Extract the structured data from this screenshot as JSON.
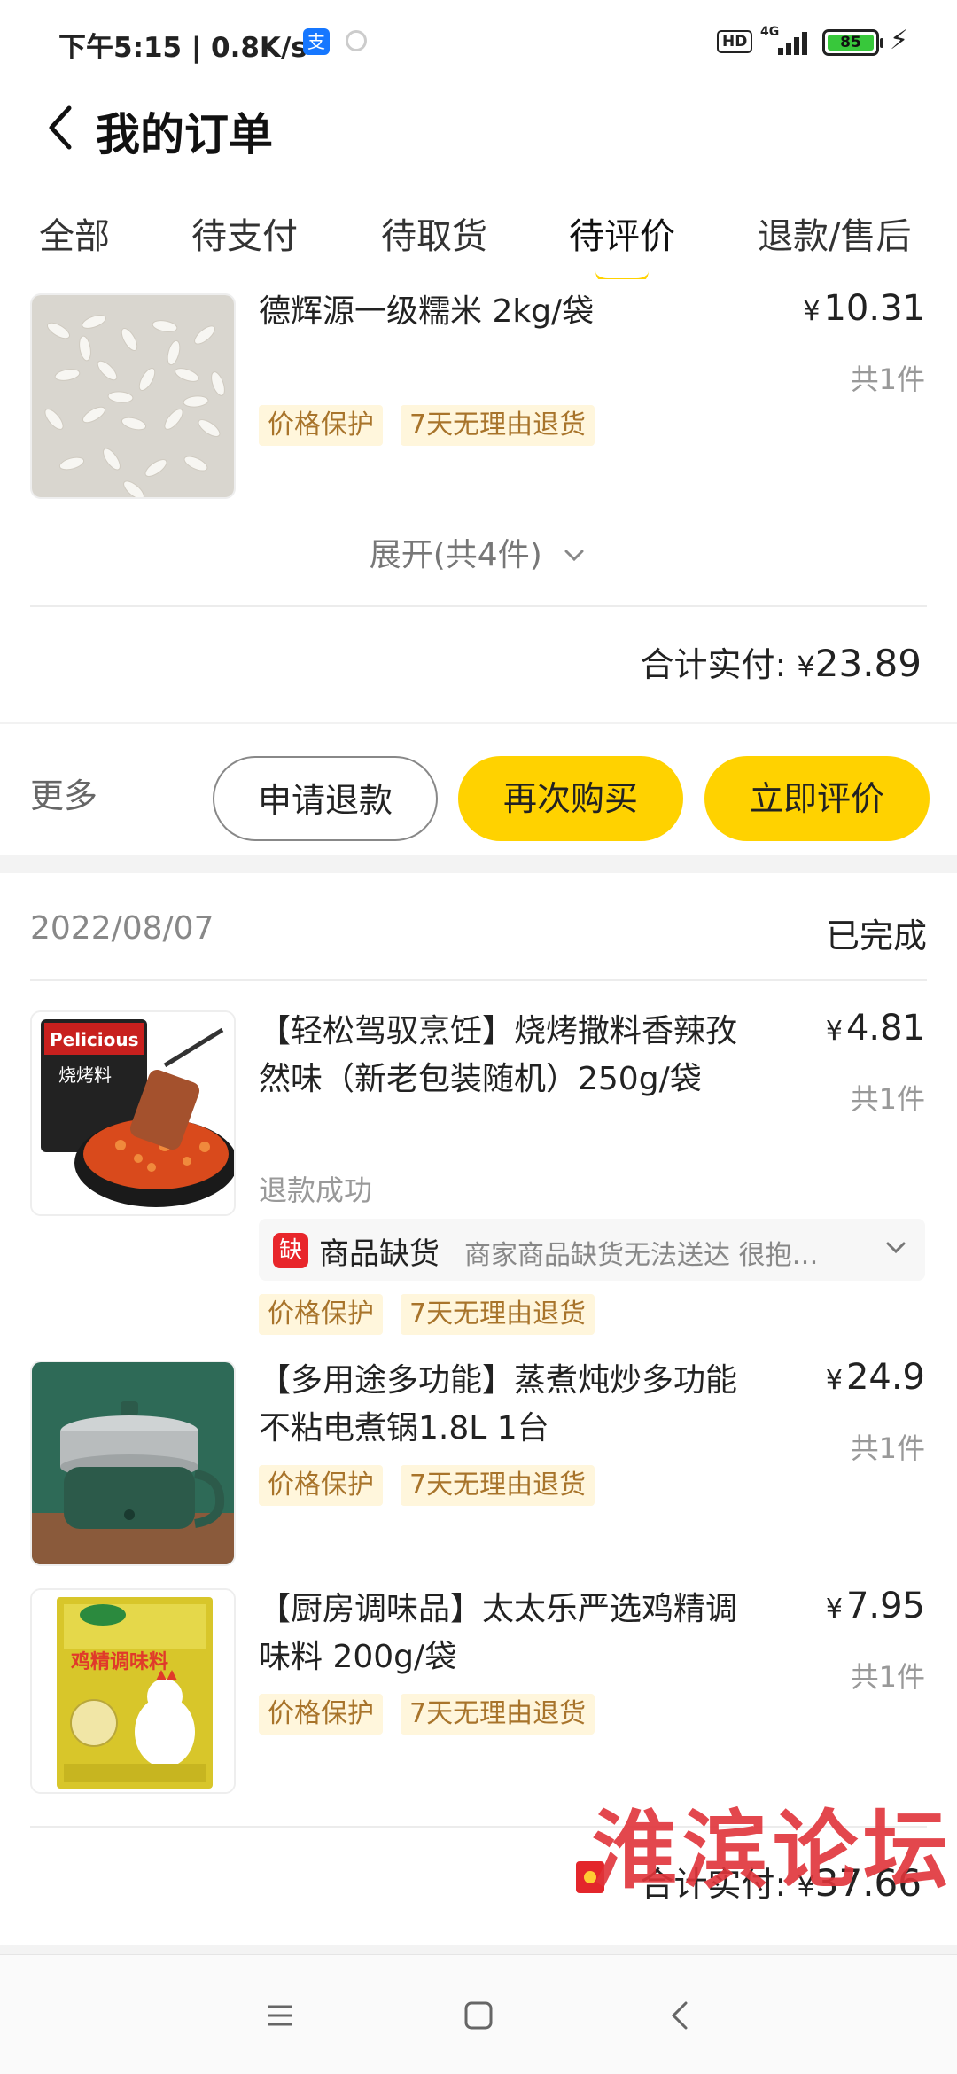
{
  "status_bar": {
    "time": "下午5:15 | 0.8K/s",
    "network": "4G",
    "hd": "HD",
    "battery": "85"
  },
  "header": {
    "title": "我的订单"
  },
  "tabs": [
    {
      "label": "全部"
    },
    {
      "label": "待支付"
    },
    {
      "label": "待取货"
    },
    {
      "label": "待评价",
      "active": true
    },
    {
      "label": "退款/售后"
    }
  ],
  "order1": {
    "item": {
      "name": "德辉源一级糯米 2kg/袋",
      "price": "10.31",
      "qty": "共1件",
      "badges": [
        "价格保护",
        "7天无理由退货"
      ]
    },
    "expand": "展开(共4件)",
    "total_label": "合计实付: ",
    "total_amount": "23.89",
    "more": "更多",
    "buttons": {
      "refund": "申请退款",
      "rebuy": "再次购买",
      "review": "立即评价"
    }
  },
  "order2": {
    "date": "2022/08/07",
    "status": "已完成",
    "items": [
      {
        "name": "【轻松驾驭烹饪】烧烤撒料香辣孜然味（新老包装随机）250g/袋",
        "price": "4.81",
        "qty": "共1件",
        "refund_status": "退款成功",
        "oos_tag": "缺",
        "oos_label": "商品缺货",
        "oos_desc": "商家商品缺货无法送达 很抱…",
        "badges": [
          "价格保护",
          "7天无理由退货"
        ],
        "img_text": "Pelicious",
        "img_sub": "烧烤料"
      },
      {
        "name": "【多用途多功能】蒸煮炖炒多功能不粘电煮锅1.8L 1台",
        "price": "24.9",
        "qty": "共1件",
        "badges": [
          "价格保护",
          "7天无理由退货"
        ]
      },
      {
        "name": "【厨房调味品】太太乐严选鸡精调味料 200g/袋",
        "price": "7.95",
        "qty": "共1件",
        "badges": [
          "价格保护",
          "7天无理由退货"
        ],
        "img_text": "鸡精调味料"
      }
    ],
    "total_label": "合计实付: ",
    "total_amount": "37.66"
  },
  "currency": "¥",
  "watermark": "淮滨论坛",
  "colors": {
    "accent": "#ffd200",
    "badge_bg": "#fff6dc",
    "badge_text": "#a8742b",
    "oos_red": "#e8262b"
  }
}
